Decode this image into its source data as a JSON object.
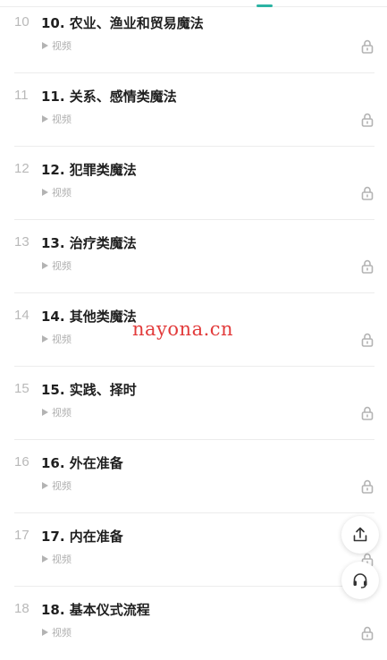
{
  "lessons": [
    {
      "index": "10",
      "title": "10. 农业、渔业和贸易魔法",
      "type_label": "视频"
    },
    {
      "index": "11",
      "title": "11. 关系、感情类魔法",
      "type_label": "视频"
    },
    {
      "index": "12",
      "title": "12. 犯罪类魔法",
      "type_label": "视频"
    },
    {
      "index": "13",
      "title": "13. 治疗类魔法",
      "type_label": "视频"
    },
    {
      "index": "14",
      "title": "14. 其他类魔法",
      "type_label": "视频"
    },
    {
      "index": "15",
      "title": "15. 实践、择时",
      "type_label": "视频"
    },
    {
      "index": "16",
      "title": "16. 外在准备",
      "type_label": "视频"
    },
    {
      "index": "17",
      "title": "17. 内在准备",
      "type_label": "视频"
    },
    {
      "index": "18",
      "title": "18. 基本仪式流程",
      "type_label": "视频"
    }
  ],
  "watermark": "nayona.cn",
  "icons": {
    "play": "play-icon",
    "lock": "lock-icon",
    "share": "share-icon",
    "support": "headset-icon"
  },
  "colors": {
    "accent": "#2bb3a3",
    "watermark": "#e23b3b"
  }
}
